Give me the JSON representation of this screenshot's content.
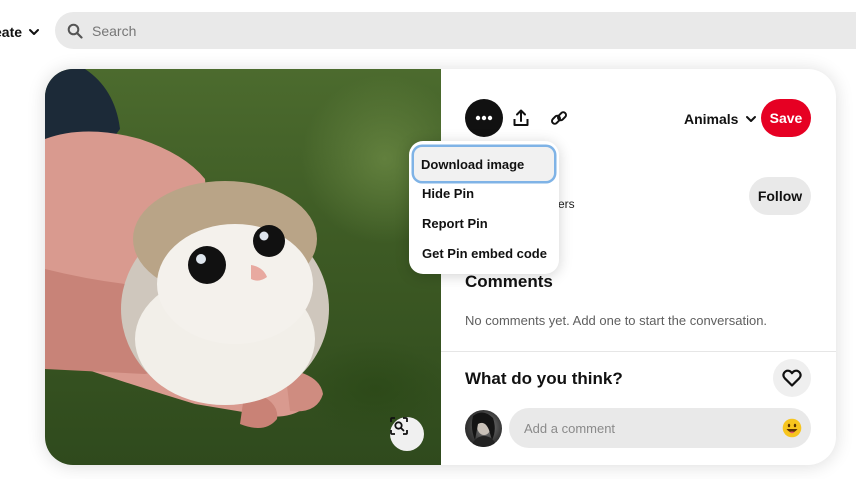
{
  "header": {
    "create_label": "eate",
    "search_placeholder": "Search"
  },
  "pin": {
    "board_label": "Animals",
    "save_label": "Save",
    "follow_label": "Follow",
    "followers_partial": "ers"
  },
  "menu": {
    "items": [
      {
        "label": "Download image"
      },
      {
        "label": "Hide Pin"
      },
      {
        "label": "Report Pin"
      },
      {
        "label": "Get Pin embed code"
      }
    ]
  },
  "comments": {
    "heading": "Comments",
    "empty_text": "No comments yet. Add one to start the conversation.",
    "prompt_heading": "What do you think?",
    "input_placeholder": "Add a comment"
  },
  "icons": {
    "more": "ellipsis-icon",
    "share": "share-upload-icon",
    "link": "link-icon",
    "lens": "visual-search-icon",
    "heart": "heart-icon",
    "emoji": "emoji-icon",
    "search": "search-icon"
  },
  "colors": {
    "save": "#e60023",
    "focus_ring": "#7fb3e6"
  }
}
